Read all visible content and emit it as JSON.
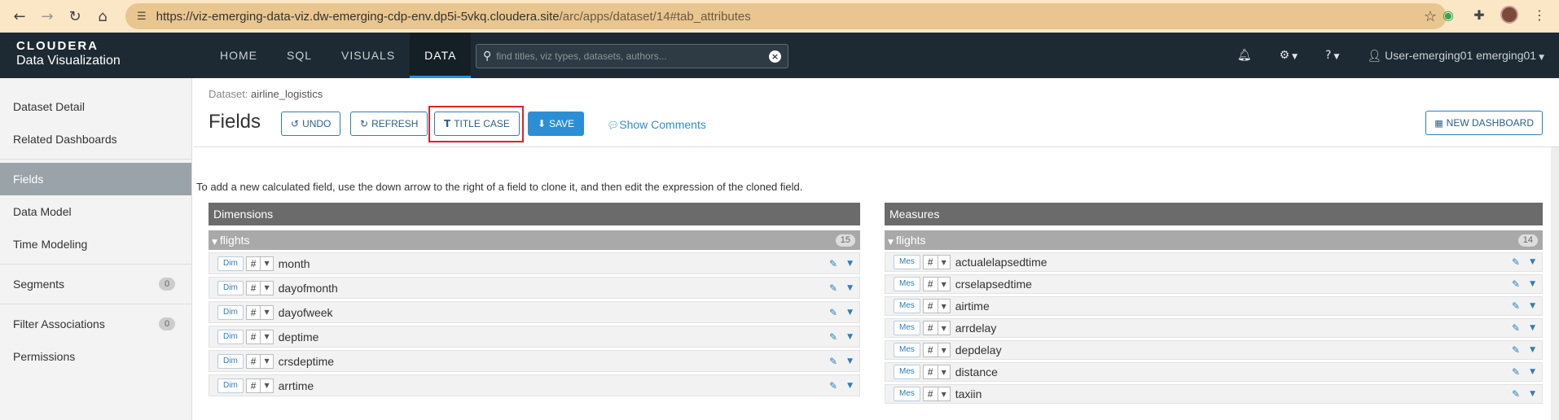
{
  "browser": {
    "url_main": "https://viz-emerging-data-viz.dw-emerging-cdp-env.dp5i-5vkq.cloudera.site",
    "url_rest": "/arc/apps/dataset/14#tab_attributes"
  },
  "header": {
    "brand": "CLOUDERA",
    "product": "Data Visualization",
    "nav": [
      "HOME",
      "SQL",
      "VISUALS",
      "DATA"
    ],
    "active_nav": "DATA",
    "search_placeholder": "find titles, viz types, datasets, authors...",
    "user_label": "User-emerging01 emerging01"
  },
  "sidebar": {
    "items": [
      {
        "label": "Dataset Detail"
      },
      {
        "label": "Related Dashboards"
      },
      {
        "label": "Fields"
      },
      {
        "label": "Data Model"
      },
      {
        "label": "Time Modeling"
      },
      {
        "label": "Segments",
        "count": "0"
      },
      {
        "label": "Filter Associations",
        "count": "0"
      },
      {
        "label": "Permissions"
      }
    ]
  },
  "main": {
    "dataset_label": "Dataset:",
    "dataset_name": "airline_logistics",
    "title": "Fields",
    "buttons": {
      "undo": "UNDO",
      "refresh": "REFRESH",
      "title_case": "TITLE CASE",
      "save": "SAVE",
      "show_comments": "Show Comments",
      "new_dashboard": "NEW DASHBOARD"
    },
    "hint": "To add a new calculated field, use the down arrow to the right of a field to clone it, and then edit the expression of the cloned field."
  },
  "dimensions": {
    "title": "Dimensions",
    "group": "flights",
    "count": "15",
    "role": "Dim",
    "type": "#",
    "fields": [
      "month",
      "dayofmonth",
      "dayofweek",
      "deptime",
      "crsdeptime",
      "arrtime"
    ]
  },
  "measures": {
    "title": "Measures",
    "group": "flights",
    "count": "14",
    "role": "Mes",
    "type": "#",
    "fields": [
      "actualelapsedtime",
      "crselapsedtime",
      "airtime",
      "arrdelay",
      "depdelay",
      "distance",
      "taxiin"
    ]
  }
}
